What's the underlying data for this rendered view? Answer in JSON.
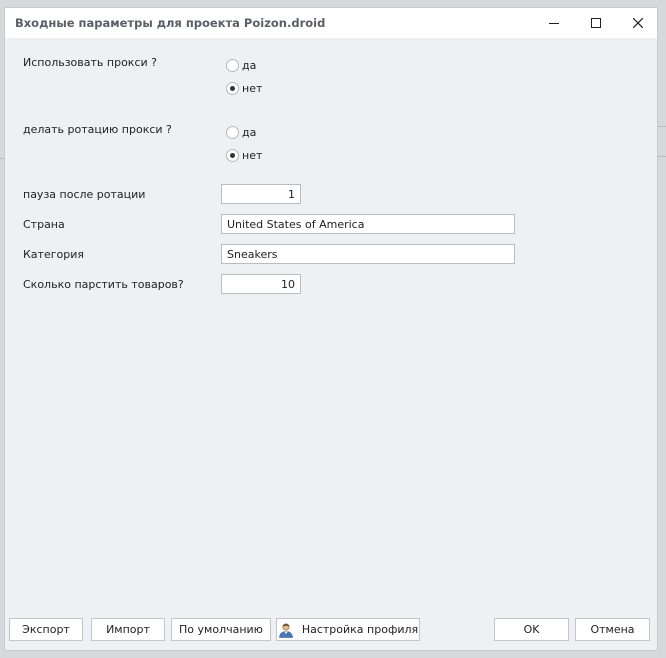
{
  "window": {
    "title": "Входные параметры для проекта Poizon.droid",
    "minimize_icon": "minimize-icon",
    "maximize_icon": "maximize-icon",
    "close_icon": "close-icon"
  },
  "form": {
    "use_proxy": {
      "label": "Использовать прокси ?",
      "options": [
        "да",
        "нет"
      ],
      "selected": "нет"
    },
    "rotate_proxy": {
      "label": "делать ротацию прокси ?",
      "options": [
        "да",
        "нет"
      ],
      "selected": "нет"
    },
    "pause_after_rotation": {
      "label": "пауза после ротации",
      "value": "1"
    },
    "country": {
      "label": "Страна",
      "value": "United States of America"
    },
    "category": {
      "label": "Категория",
      "value": "Sneakers"
    },
    "items_count": {
      "label": "Сколько парстить товаров?",
      "value": "10"
    }
  },
  "footer": {
    "export": "Экспорт",
    "import": "Импорт",
    "defaults": "По умолчанию",
    "profile_settings": "Настройка профиля",
    "profile_icon": "user-profile-icon",
    "ok": "OK",
    "cancel": "Отмена"
  }
}
